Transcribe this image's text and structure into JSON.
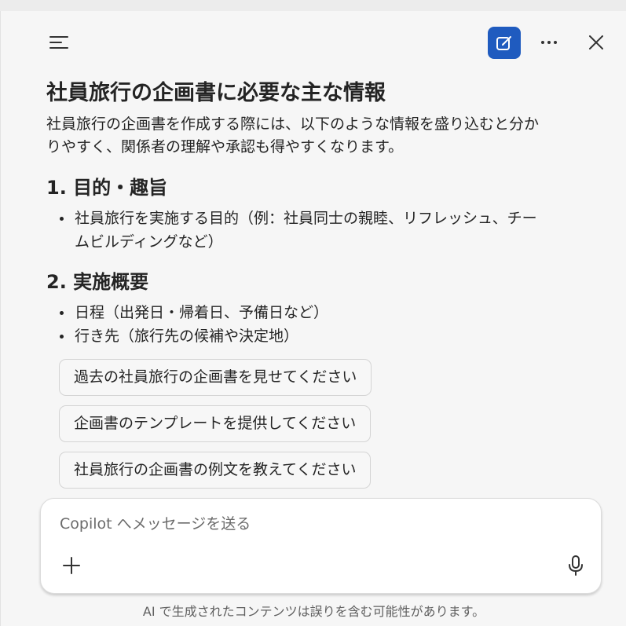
{
  "header": {
    "menu_icon": "menu-lines-icon",
    "new_chat_icon": "new-chat-compose-icon",
    "more_icon": "more-horizontal-icon",
    "close_icon": "close-icon",
    "accent_color": "#1f5bbf"
  },
  "message": {
    "title": "社員旅行の企画書に必要な主な情報",
    "intro_line1": "社員旅行の企画書を作成する際には、以下のような情報を盛り込むと分か",
    "intro_line2": "りやすく、関係者の理解や承認も得やすくなります。",
    "sections": [
      {
        "heading": "1. 目的・趣旨",
        "bullets": [
          {
            "line1": "社員旅行を実施する目的（例：社員同士の親睦、リフレッシュ、チー",
            "line2": "ムビルディングなど）"
          }
        ]
      },
      {
        "heading": "2. 実施概要",
        "bullets": [
          {
            "line1": "日程（出発日・帰着日、予備日など）"
          },
          {
            "line1": "行き先（旅行先の候補や決定地）"
          }
        ]
      }
    ]
  },
  "suggestions": [
    "過去の社員旅行の企画書を見せてください",
    "企画書のテンプレートを提供してください",
    "社員旅行の企画書の例文を教えてください"
  ],
  "composer": {
    "placeholder": "Copilot へメッセージを送る",
    "value": "",
    "add_icon": "plus-icon",
    "mic_icon": "microphone-icon"
  },
  "footer": {
    "disclaimer": "AI で生成されたコンテンツは誤りを含む可能性があります。"
  }
}
